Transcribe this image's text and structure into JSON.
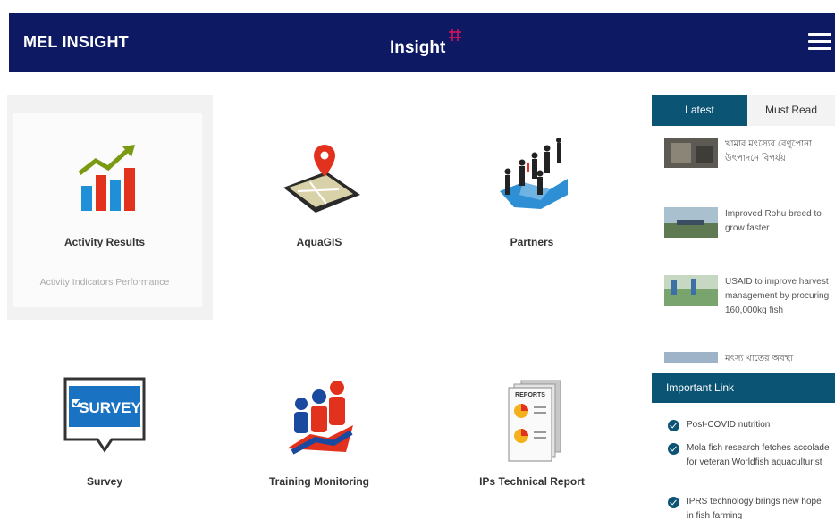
{
  "header": {
    "brand": "MEL INSIGHT",
    "logo_text": "Insight",
    "logo_mark_color": "#d4145a",
    "background": "#0d1a63",
    "menu_icon": "hamburger-menu-icon"
  },
  "tiles": [
    {
      "label": "Activity Results",
      "subtitle": "Activity Indicators Performance",
      "icon": "bar-chart-trend-icon",
      "highlighted": true
    },
    {
      "label": "AquaGIS",
      "icon": "map-location-pin-icon"
    },
    {
      "label": "Partners",
      "icon": "people-puzzle-icon"
    },
    {
      "label": "Survey",
      "icon": "survey-badge-icon"
    },
    {
      "label": "Training Monitoring",
      "icon": "training-people-icon"
    },
    {
      "label": "IPs Technical Report",
      "icon": "reports-document-icon"
    }
  ],
  "sidebar": {
    "tabs": [
      {
        "label": "Latest",
        "active": true
      },
      {
        "label": "Must Read",
        "active": false
      }
    ],
    "news": [
      {
        "title": "খামার মৎস্যের রেণুপোনা উৎপাদনে বিপর্যয়"
      },
      {
        "title": "Improved Rohu breed to grow faster"
      },
      {
        "title": "USAID to improve harvest management by procuring 160,000kg fish"
      },
      {
        "title": "মৎস্য খাতের অবস্থা"
      }
    ],
    "important_link_title": "Important Link",
    "links": [
      {
        "text": "Post-COVID nutrition"
      },
      {
        "text": "Mola fish research fetches accolade for veteran Worldfish aquaculturist"
      },
      {
        "text": "IPRS technology brings new hope in fish farming"
      }
    ]
  },
  "colors": {
    "navy": "#0d1a63",
    "teal": "#0b5474",
    "accent_red": "#e2311d",
    "accent_blue": "#1f8fd8"
  }
}
